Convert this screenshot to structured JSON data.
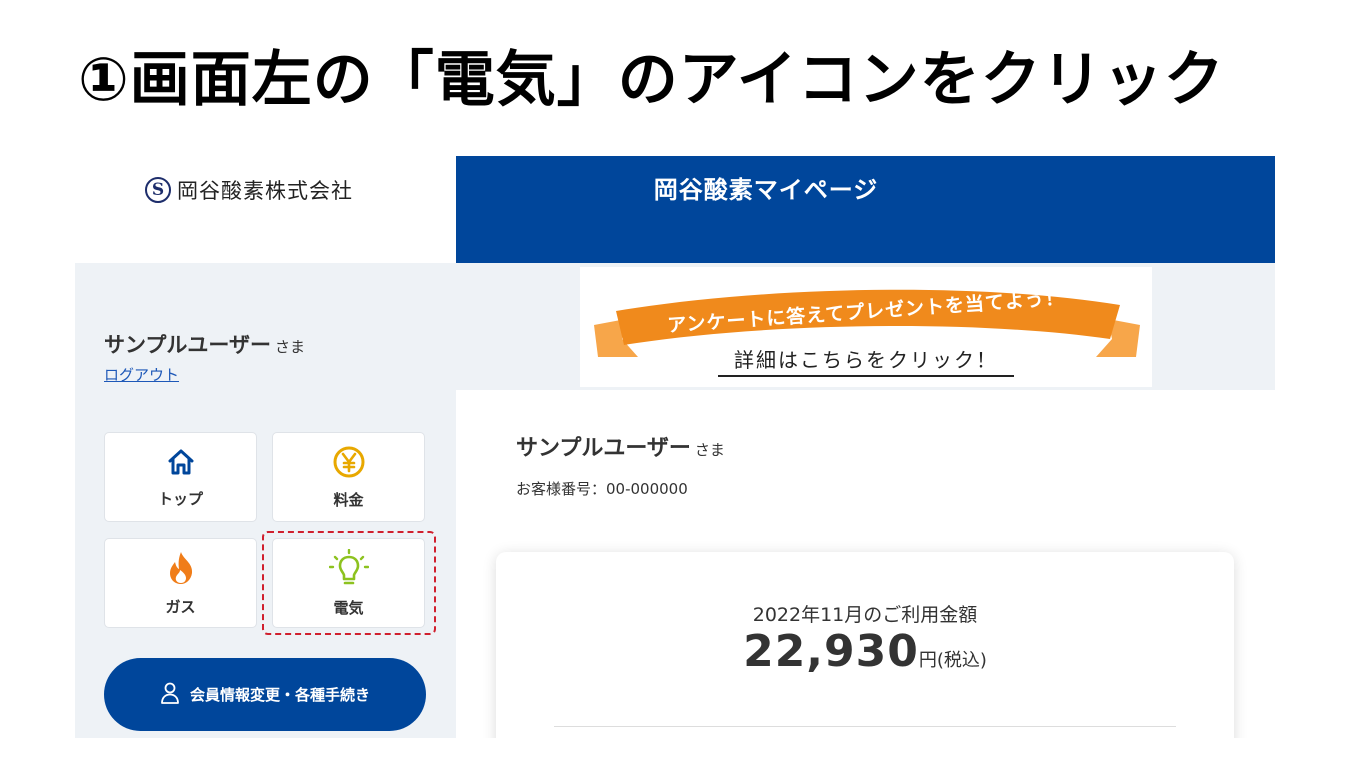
{
  "slide": {
    "title": "①画面左の「電気」のアイコンをクリック"
  },
  "logo": {
    "mark": "S",
    "text": "岡谷酸素株式会社"
  },
  "header": {
    "title": "岡谷酸素マイページ"
  },
  "sidebar": {
    "user_name": "サンプルユーザー",
    "honorific": "さま",
    "logout_label": "ログアウト",
    "tiles": [
      {
        "label": "トップ",
        "icon": "home-icon"
      },
      {
        "label": "料金",
        "icon": "yen-icon"
      },
      {
        "label": "ガス",
        "icon": "flame-icon"
      },
      {
        "label": "電気",
        "icon": "lightbulb-icon"
      }
    ],
    "member_button_label": "会員情報変更・各種手続き"
  },
  "banner": {
    "headline": "アンケートに答えてプレゼントを当てよう！",
    "sub": "詳細はこちらをクリック！"
  },
  "main": {
    "user_name": "サンプルユーザー",
    "honorific": "さま",
    "customer_number": "お客様番号：00-000000",
    "usage_label": "2022年11月のご利用金額",
    "usage_amount": "22,930",
    "usage_unit": "円(税込)"
  },
  "colors": {
    "brand_blue": "#00469b",
    "sidebar_bg": "#eef2f6",
    "highlight_red": "#d0202e",
    "ribbon_orange": "#f08a1c",
    "yen_yellow": "#e8a800",
    "flame_orange": "#f07d19",
    "bulb_green": "#8dc21f"
  }
}
